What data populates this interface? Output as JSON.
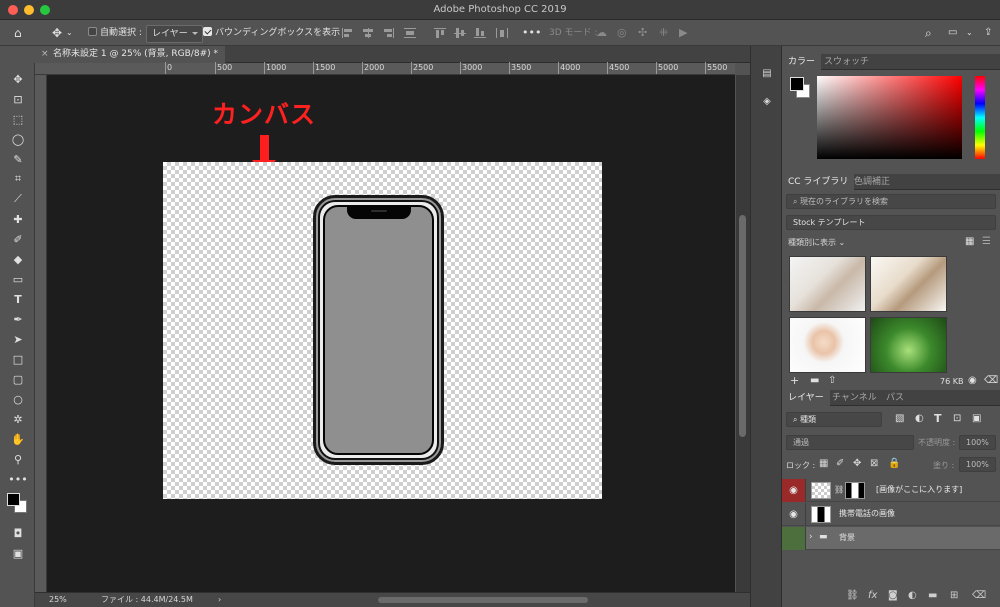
{
  "window": {
    "title": "Adobe Photoshop CC 2019"
  },
  "options_bar": {
    "auto_select_label": "自動選択 :",
    "auto_select_value": "レイヤー",
    "bounding_box_label": "バウンディングボックスを表示",
    "mode_3d_label": "3D モード :"
  },
  "document": {
    "tab_title": "名称未設定 1 @ 25% (背景, RGB/8#) *",
    "close_symbol": "×"
  },
  "ruler": {
    "labels": [
      "0",
      "500",
      "1000",
      "1500",
      "2000",
      "2500",
      "3000",
      "3500",
      "4000",
      "4500",
      "5000",
      "5500"
    ]
  },
  "annotation": {
    "text": "カンバス"
  },
  "status_bar": {
    "zoom": "25%",
    "file_info": "ファイル : 44.4M/24.5M",
    "arrow": "›"
  },
  "color_panel": {
    "tabs": [
      "カラー",
      "スウォッチ"
    ]
  },
  "libraries_panel": {
    "tabs": [
      "CC ライブラリ",
      "色調補正"
    ],
    "search_placeholder": "現在のライブラリを検索",
    "library_select": "Stock テンプレート",
    "view_by": "種類別に表示",
    "size": "76 KB"
  },
  "layers_panel": {
    "tabs": [
      "レイヤー",
      "チャンネル",
      "パス"
    ],
    "filter_kind": "種類",
    "blend_mode": "通過",
    "opacity_label": "不透明度 :",
    "opacity_value": "100%",
    "lock_label": "ロック :",
    "fill_label": "塗り :",
    "fill_value": "100%",
    "layers": [
      {
        "name": "[画像がここに入ります]",
        "visible": true
      },
      {
        "name": "携帯電話の画像",
        "visible": true
      },
      {
        "name": "背景",
        "visible": false
      }
    ]
  },
  "colors": {
    "annotation": "#ff2020",
    "selected_layer": "#9a2a2a",
    "group_eye": "#4d6e3d"
  }
}
